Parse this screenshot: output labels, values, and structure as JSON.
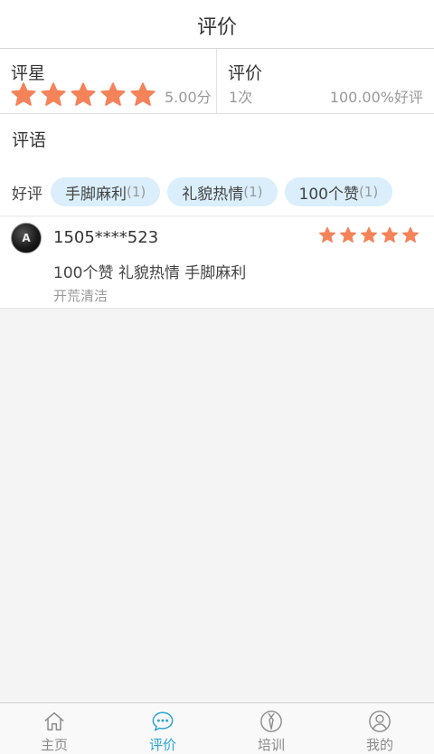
{
  "header": {
    "title": "评价"
  },
  "summary": {
    "rating_title": "评星",
    "stars": 5,
    "score": "5.00分",
    "review_title": "评价",
    "count": "1次",
    "positive_rate": "100.00%好评"
  },
  "comments": {
    "title": "评语",
    "group_label": "好评",
    "tags": [
      {
        "label": "手脚麻利",
        "count": "(1)"
      },
      {
        "label": "礼貌热情",
        "count": "(1)"
      },
      {
        "label": "100个赞",
        "count": "(1)"
      }
    ]
  },
  "review": {
    "avatar_text": "A",
    "user": "1505****523",
    "stars": 5,
    "text": "100个赞 礼貌热情 手脚麻利",
    "service": "开荒清洁"
  },
  "tabbar": {
    "items": [
      {
        "label": "主页",
        "icon": "home-icon",
        "active": false
      },
      {
        "label": "评价",
        "icon": "chat-bubble-icon",
        "active": true
      },
      {
        "label": "培训",
        "icon": "tie-icon",
        "active": false
      },
      {
        "label": "我的",
        "icon": "user-icon",
        "active": false
      }
    ]
  },
  "colors": {
    "star": "#f5835a",
    "accent": "#2aa6d6",
    "tag_bg": "#daeefb"
  }
}
